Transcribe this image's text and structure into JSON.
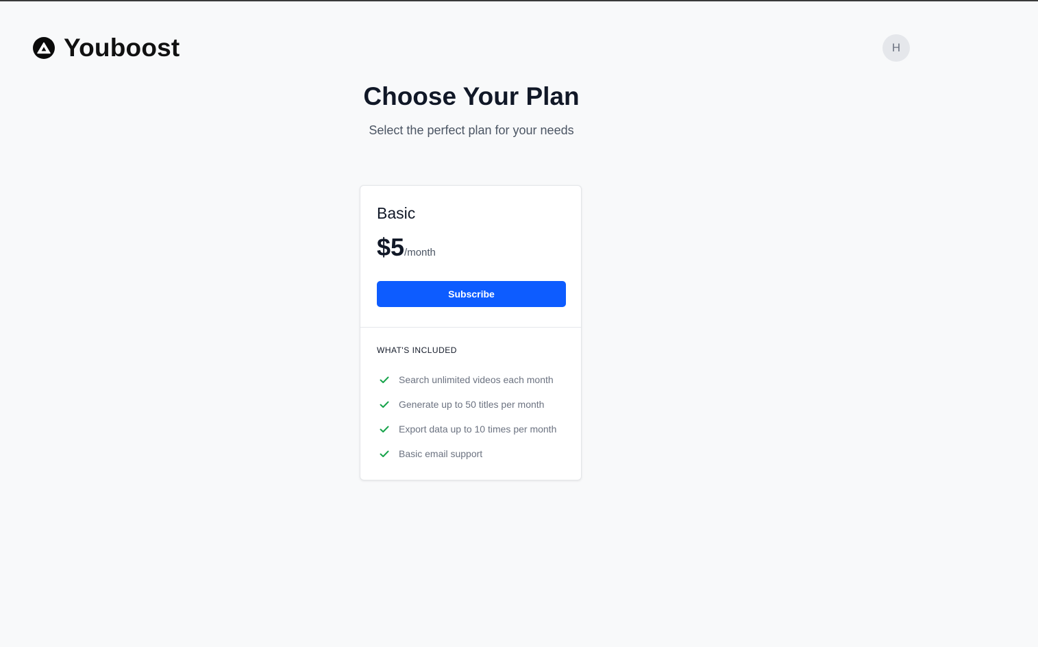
{
  "header": {
    "brand": "Youboost",
    "avatar_initial": "H"
  },
  "main": {
    "title": "Choose Your Plan",
    "subtitle": "Select the perfect plan for your needs"
  },
  "plan": {
    "name": "Basic",
    "price": "$5",
    "period": "/month",
    "subscribe_label": "Subscribe",
    "included_title": "WHAT'S INCLUDED",
    "features": [
      "Search unlimited videos each month",
      "Generate up to 50 titles per month",
      "Export data up to 10 times per month",
      "Basic email support"
    ]
  },
  "colors": {
    "accent": "#0d5cff",
    "check": "#16a34a",
    "background": "#f8f9fa"
  },
  "icons": {
    "logo": "triangle-logo-icon",
    "feature": "check-icon"
  }
}
